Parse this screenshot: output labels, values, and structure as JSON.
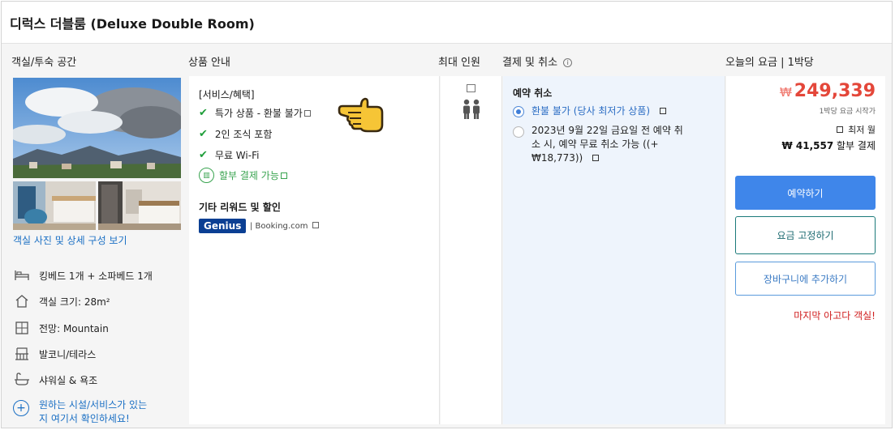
{
  "title": "디럭스 더블룸 (Deluxe Double Room)",
  "columns": {
    "room": "객실/투숙 공간",
    "info": "상품 안내",
    "occupancy": "최대 인원",
    "cancel": "결제 및 취소",
    "price": "오늘의 요금 | 1박당"
  },
  "room_panel": {
    "photo_link": "객실 사진 및 상세 구성 보기",
    "features": [
      {
        "icon": "bed-icon",
        "label": "킹베드 1개 + 소파베드 1개"
      },
      {
        "icon": "house-icon",
        "label": "객실 크기: 28m²"
      },
      {
        "icon": "window-icon",
        "label": "전망: Mountain"
      },
      {
        "icon": "balcony-icon",
        "label": "발코니/테라스"
      },
      {
        "icon": "bath-icon",
        "label": "샤워실 & 욕조"
      }
    ],
    "more_line1": "원하는 시설/서비스가 있는",
    "more_line2": "지 여기서 확인하세요!"
  },
  "info_panel": {
    "benefits_title": "[서비스/혜택]",
    "benefits": [
      "특가 상품 - 환불 불가",
      "2인 조식 포함",
      "무료 Wi-Fi"
    ],
    "installment": "할부 결제 가능",
    "rewards_title": "기타 리워드 및 할인",
    "genius": "Genius",
    "booking": "| Booking.com"
  },
  "cancel_panel": {
    "title": "예약 취소",
    "option1": "환불 불가 (당사 최저가 상품)",
    "option2_line1": "2023년 9월 22일 금요일 전 예약 취",
    "option2_line2": "소 시, 예약 무료 취소 가능 ((+",
    "option2_line3": "₩18,773))"
  },
  "price_panel": {
    "currency": "₩",
    "price": "249,339",
    "per_night": "1박당 요금 시작가",
    "installment_label": "최저 월",
    "installment_amount": "₩ 41,557",
    "installment_suffix": "할부 결제",
    "book_button": "예약하기",
    "lock_button": "요금 고정하기",
    "cart_button": "장바구니에 추가하기",
    "last_room": "마지막 아고다 객실!"
  },
  "colors": {
    "accent_blue": "#3f86ea",
    "price_red": "#e4473a",
    "check_green": "#1f9e3a",
    "link_blue": "#1a6fc4"
  }
}
